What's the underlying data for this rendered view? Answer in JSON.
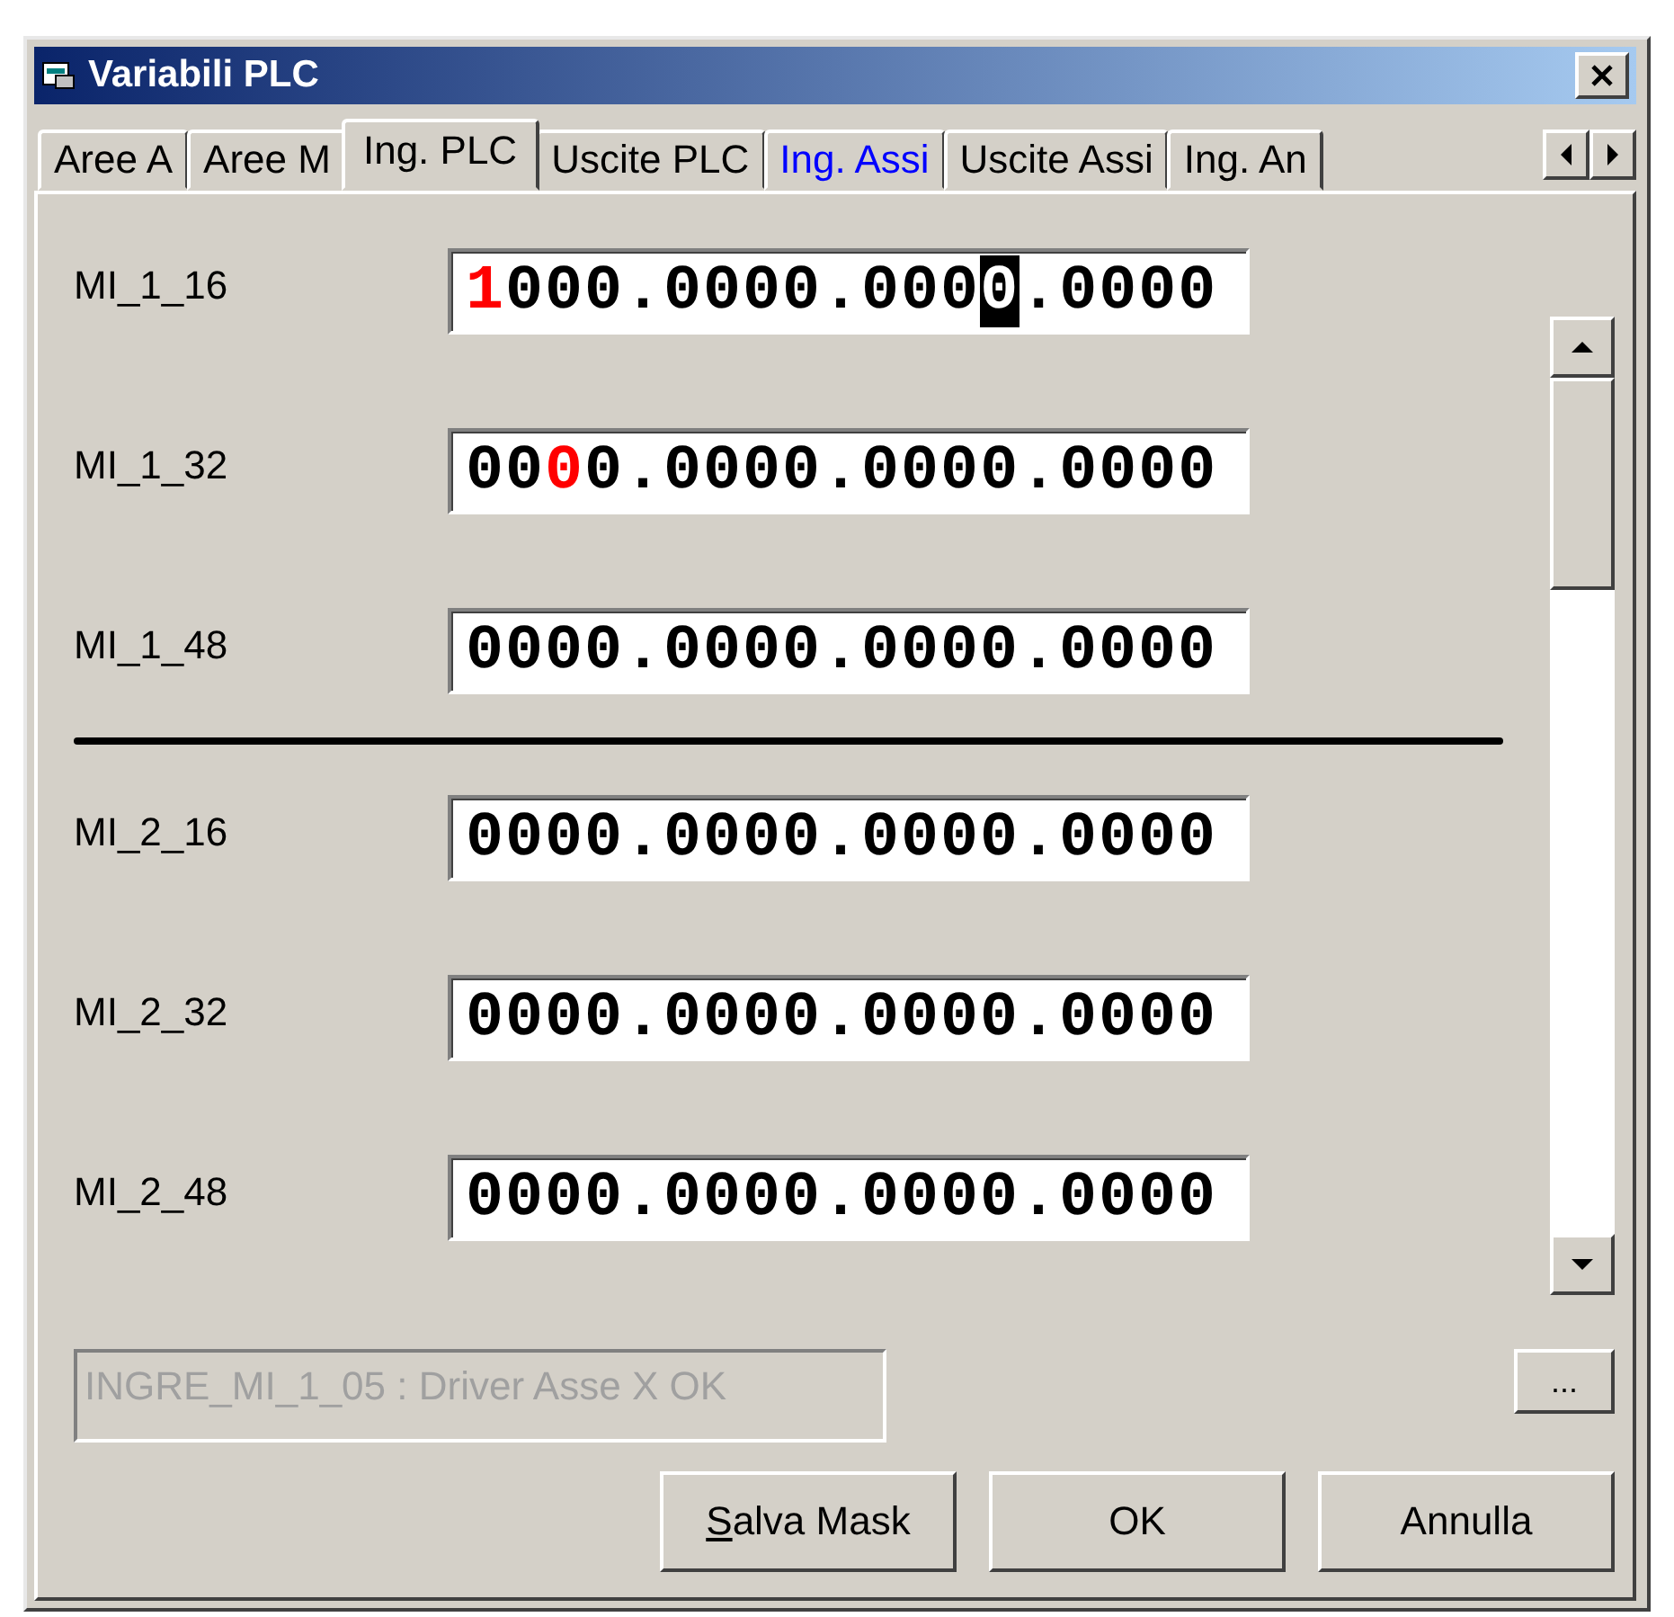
{
  "window": {
    "title": "Variabili PLC"
  },
  "tabs": [
    {
      "label": "Aree A",
      "selected": false,
      "highlighted": false
    },
    {
      "label": "Aree M",
      "selected": false,
      "highlighted": false
    },
    {
      "label": "Ing. PLC",
      "selected": true,
      "highlighted": false
    },
    {
      "label": "Uscite PLC",
      "selected": false,
      "highlighted": false
    },
    {
      "label": "Ing. Assi",
      "selected": false,
      "highlighted": true
    },
    {
      "label": "Uscite Assi",
      "selected": false,
      "highlighted": false
    },
    {
      "label": "Ing. An",
      "selected": false,
      "highlighted": false
    }
  ],
  "groups": [
    {
      "rows": [
        {
          "label": "MI_1_16",
          "segments": [
            {
              "text": "1",
              "kind": "changed"
            },
            {
              "text": "000.0000.000",
              "kind": "plain"
            },
            {
              "text": "0",
              "kind": "cursor"
            },
            {
              "text": ".0000",
              "kind": "plain"
            }
          ]
        },
        {
          "label": "MI_1_32",
          "segments": [
            {
              "text": "00",
              "kind": "plain"
            },
            {
              "text": "0",
              "kind": "changed"
            },
            {
              "text": "0.0000.0000.0000",
              "kind": "plain"
            }
          ]
        },
        {
          "label": "MI_1_48",
          "segments": [
            {
              "text": "0000.0000.0000.0000",
              "kind": "plain"
            }
          ]
        }
      ]
    },
    {
      "rows": [
        {
          "label": "MI_2_16",
          "segments": [
            {
              "text": "0000.0000.0000.0000",
              "kind": "plain"
            }
          ]
        },
        {
          "label": "MI_2_32",
          "segments": [
            {
              "text": "0000.0000.0000.0000",
              "kind": "plain"
            }
          ]
        },
        {
          "label": "MI_2_48",
          "segments": [
            {
              "text": "0000.0000.0000.0000",
              "kind": "plain"
            }
          ]
        }
      ]
    }
  ],
  "status_field": {
    "value": "INGRE_MI_1_05 : Driver Asse X OK",
    "disabled": true
  },
  "more_button": {
    "label": "..."
  },
  "buttons": [
    {
      "label": "Salva Mask",
      "mnemonic": true
    },
    {
      "label": "OK",
      "mnemonic": false
    },
    {
      "label": "Annulla",
      "mnemonic": false
    }
  ]
}
